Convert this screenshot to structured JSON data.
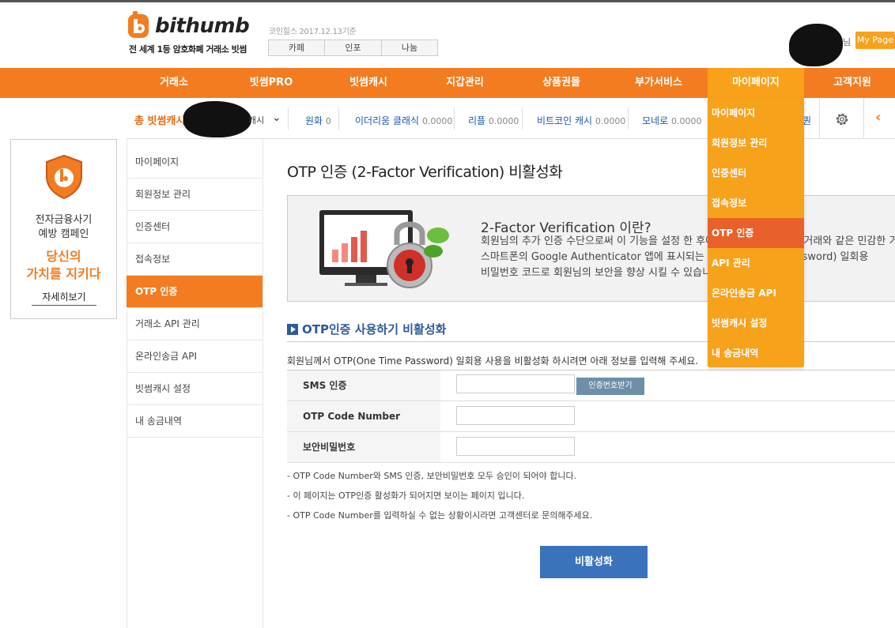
{
  "header": {
    "logo_text": "bithumb",
    "tagline": "전 세계 1등 암호화폐 거래소 빗썸",
    "coinhills": "코인힐스 2017.12.13기준",
    "buttons": [
      "카페",
      "인포",
      "나눔"
    ],
    "user_suffix": "님",
    "mypage_label": "My Page"
  },
  "nav": {
    "items": [
      "거래소",
      "빗썸PRO",
      "빗썸캐시",
      "지갑관리",
      "상품권몰",
      "부가서비스",
      "마이페이지",
      "고객지원"
    ],
    "active": "마이페이지"
  },
  "subbar": {
    "total_label": "총 빗썸캐시",
    "total_unit": "캐시",
    "balances": [
      {
        "name": "원화",
        "value": "0"
      },
      {
        "name": "이더리움 클래식",
        "value": "0.0000"
      },
      {
        "name": "리플",
        "value": "0.0000"
      },
      {
        "name": "비트코인 캐시",
        "value": "0.0000"
      },
      {
        "name": "모네로",
        "value": "0.0000"
      }
    ],
    "trailing": "퀀"
  },
  "banner": {
    "line1": "전자금융사기",
    "line2": "예방 캠페인",
    "line3": "당신의",
    "line4": "가치를 지키다",
    "link": "자세히보기"
  },
  "sidemenu": {
    "items": [
      "마이페이지",
      "회원정보 관리",
      "인증센터",
      "접속정보",
      "OTP 인증",
      "거래소 API 관리",
      "온라인송금 API",
      "빗썸캐시 설정",
      "내 송금내역"
    ],
    "active": "OTP 인증"
  },
  "main": {
    "title": "OTP 인증 (2-Factor Verification) 비활성화",
    "info_title": "2-Factor Verification 이란?",
    "info_lines": [
      "회원님의 추가 인증 수단으로써 이 기능을 설정 한 후에는 출금 등의 중요한 거래와 같은 민감한 거래를",
      "스마트폰의 Google Authenticator 앱에 표시되는 OTP(One Time Password) 일회용",
      "비밀번호 코드로 회원님의 보안을 향상 시킬 수 있습니다."
    ],
    "section_title": "OTP인증 사용하기 비활성화",
    "section_desc": "회원님께서 OTP(One Time Password) 일회용 사용을 비활성화 하시려면 아래 정보를 입력해 주세요.",
    "form": {
      "sms_label": "SMS 인증",
      "sms_button": "인증번호받기",
      "otp_label": "OTP Code Number",
      "pw_label": "보안비밀번호"
    },
    "notes": [
      "- OTP Code Number와 SMS 인증, 보안비밀번호 모두 승인이 되어야 합니다.",
      "- 이 페이지는 OTP인증 활성화가 되어지면 보이는 페이지 입니다.",
      "- OTP Code Number를 입력하실 수 없는 상황이시라면 고객센터로 문의해주세요."
    ],
    "submit": "비활성화"
  },
  "dropdown": {
    "items": [
      "마이페이지",
      "회원정보 관리",
      "인증센터",
      "접속정보",
      "OTP 인증",
      "API 관리",
      "온라인송금 API",
      "빗썸캐시 설정",
      "내 송금내역"
    ],
    "active": "OTP 인증"
  },
  "colors": {
    "brand": "#f37c21",
    "dropdown": "#f7a21b",
    "dropdown_active": "#e8612a",
    "link_blue": "#1e5aa8",
    "button_blue": "#3a73bb"
  }
}
